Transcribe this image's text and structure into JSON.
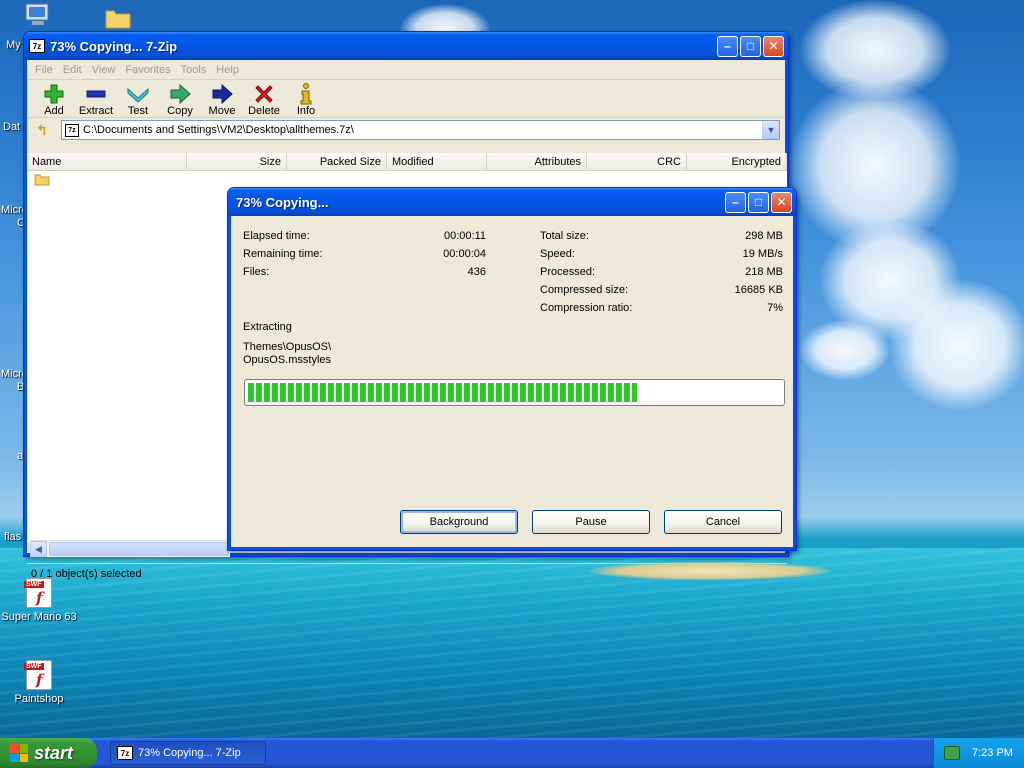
{
  "desktop": {
    "icon_labels": [
      "Super Mario 63",
      "Paintshop"
    ],
    "cut_labels": [
      "My",
      "Dat",
      "Micro",
      "C",
      "Micro",
      "B",
      "a",
      "flas"
    ]
  },
  "main_window": {
    "title": "73% Copying... 7-Zip",
    "menu": [
      "File",
      "Edit",
      "View",
      "Favorites",
      "Tools",
      "Help"
    ],
    "toolbar": [
      "Add",
      "Extract",
      "Test",
      "Copy",
      "Move",
      "Delete",
      "Info"
    ],
    "address": "C:\\Documents and Settings\\VM2\\Desktop\\allthemes.7z\\",
    "columns": [
      "Name",
      "Size",
      "Packed Size",
      "Modified",
      "Attributes",
      "CRC",
      "Encrypted"
    ],
    "status": "0 / 1 object(s) selected"
  },
  "progress_dialog": {
    "title": "73% Copying...",
    "left_stats": [
      {
        "label": "Elapsed time:",
        "value": "00:00:11"
      },
      {
        "label": "Remaining time:",
        "value": "00:00:04"
      },
      {
        "label": "Files:",
        "value": "436"
      }
    ],
    "right_stats": [
      {
        "label": "Total size:",
        "value": "298 MB"
      },
      {
        "label": "Speed:",
        "value": "19 MB/s"
      },
      {
        "label": "Processed:",
        "value": "218 MB"
      },
      {
        "label": "Compressed size:",
        "value": "16685 KB"
      },
      {
        "label": "Compression ratio:",
        "value": "7%"
      }
    ],
    "operation": "Extracting",
    "current_path_line1": "Themes\\OpusOS\\",
    "current_path_line2": "OpusOS.msstyles",
    "progress_percent": 73,
    "buttons": {
      "background": "Background",
      "pause": "Pause",
      "cancel": "Cancel"
    }
  },
  "taskbar": {
    "start_label": "start",
    "task_label": "73% Copying... 7-Zip",
    "clock": "7:23 PM"
  },
  "colors": {
    "accent": "#0a4fd6",
    "progress_fill": "#2ec72e"
  }
}
